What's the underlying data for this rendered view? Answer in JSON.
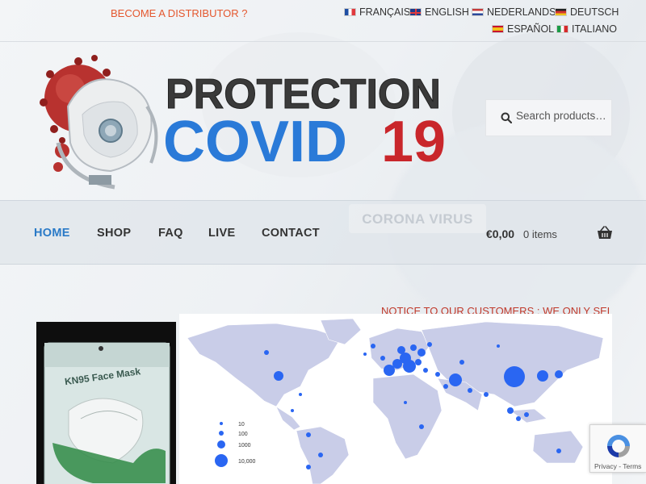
{
  "topbar": {
    "distributor_link": "BECOME A DISTRIBUTOR ?",
    "languages": [
      {
        "label": "FRANÇAIS",
        "flag": "fr"
      },
      {
        "label": "ENGLISH",
        "flag": "en"
      },
      {
        "label": "NEDERLANDS",
        "flag": "nl"
      },
      {
        "label": "DEUTSCH",
        "flag": "de"
      },
      {
        "label": "ESPAÑOL",
        "flag": "es"
      },
      {
        "label": "ITALIANO",
        "flag": "it"
      }
    ]
  },
  "logo": {
    "line1": "PROTECTION",
    "line2_blue": "COVID",
    "line2_red": "19"
  },
  "search": {
    "placeholder": "Search products…"
  },
  "nav": {
    "items": [
      {
        "label": "HOME",
        "active": true
      },
      {
        "label": "SHOP"
      },
      {
        "label": "FAQ"
      },
      {
        "label": "LIVE"
      },
      {
        "label": "CONTACT"
      }
    ],
    "cart_total": "€0,00",
    "cart_count": "0 items"
  },
  "banner": {
    "corona_text": "CORONA VIRUS",
    "notice": "NOTICE TO OUR CUSTOMERS : WE ONLY SELL OUR"
  },
  "product": {
    "package_text": "KN95 Face Mask"
  },
  "map_legend": [
    "10",
    "100",
    "1000",
    "10,000"
  ],
  "recaptcha": {
    "links": "Privacy - Terms"
  },
  "colors": {
    "accent_blue": "#2a7ac7",
    "notice_red": "#c0392b",
    "distributor_orange": "#e4572e",
    "dot_blue": "#2a66f2",
    "map_gray": "#c9cde8"
  }
}
